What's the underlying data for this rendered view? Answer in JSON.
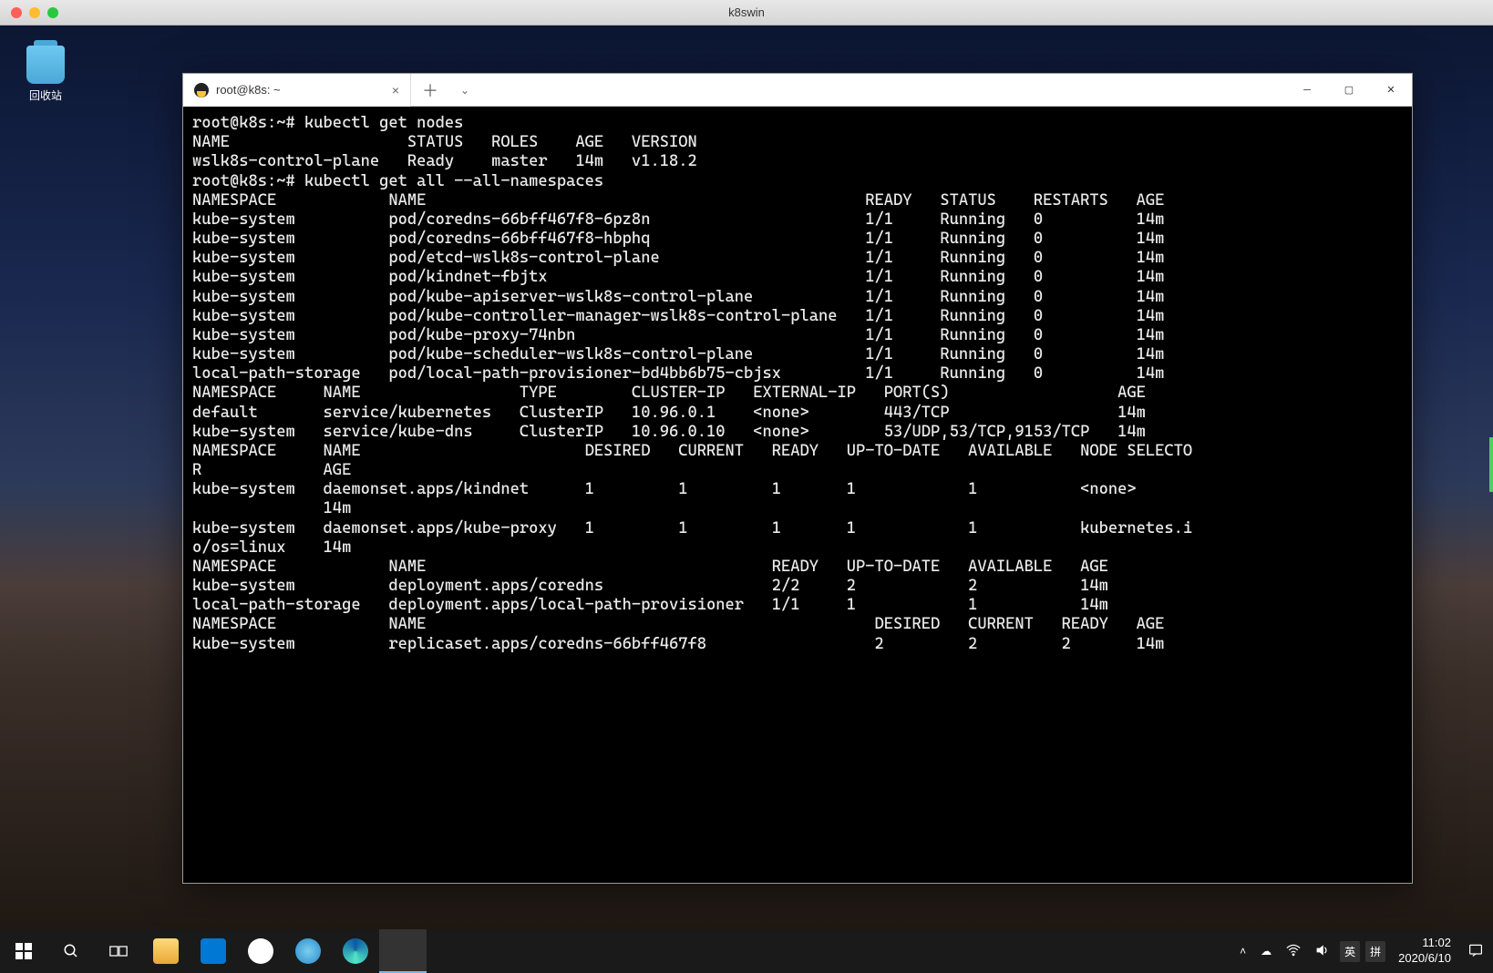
{
  "mac_titlebar": {
    "title": "k8swin"
  },
  "desktop": {
    "recycle_bin_label": "回收站"
  },
  "terminal": {
    "tab_title": "root@k8s: ~",
    "lines": [
      "root@k8s:~# kubectl get nodes",
      "NAME                   STATUS   ROLES    AGE   VERSION",
      "wslk8s-control-plane   Ready    master   14m   v1.18.2",
      "root@k8s:~# kubectl get all --all-namespaces",
      "NAMESPACE            NAME                                               READY   STATUS    RESTARTS   AGE",
      "kube-system          pod/coredns-66bff467f8-6pz8n                       1/1     Running   0          14m",
      "kube-system          pod/coredns-66bff467f8-hbphq                       1/1     Running   0          14m",
      "kube-system          pod/etcd-wslk8s-control-plane                      1/1     Running   0          14m",
      "kube-system          pod/kindnet-fbjtx                                  1/1     Running   0          14m",
      "kube-system          pod/kube-apiserver-wslk8s-control-plane            1/1     Running   0          14m",
      "kube-system          pod/kube-controller-manager-wslk8s-control-plane   1/1     Running   0          14m",
      "kube-system          pod/kube-proxy-74nbn                               1/1     Running   0          14m",
      "kube-system          pod/kube-scheduler-wslk8s-control-plane            1/1     Running   0          14m",
      "local-path-storage   pod/local-path-provisioner-bd4bb6b75-cbjsx         1/1     Running   0          14m",
      "",
      "NAMESPACE     NAME                 TYPE        CLUSTER-IP   EXTERNAL-IP   PORT(S)                  AGE",
      "default       service/kubernetes   ClusterIP   10.96.0.1    <none>        443/TCP                  14m",
      "kube-system   service/kube-dns     ClusterIP   10.96.0.10   <none>        53/UDP,53/TCP,9153/TCP   14m",
      "",
      "NAMESPACE     NAME                        DESIRED   CURRENT   READY   UP-TO-DATE   AVAILABLE   NODE SELECTO",
      "R             AGE",
      "kube-system   daemonset.apps/kindnet      1         1         1       1            1           <none>      ",
      "              14m",
      "kube-system   daemonset.apps/kube-proxy   1         1         1       1            1           kubernetes.i",
      "o/os=linux    14m",
      "",
      "NAMESPACE            NAME                                     READY   UP-TO-DATE   AVAILABLE   AGE",
      "kube-system          deployment.apps/coredns                  2/2     2            2           14m",
      "local-path-storage   deployment.apps/local-path-provisioner   1/1     1            1           14m",
      "",
      "NAMESPACE            NAME                                                DESIRED   CURRENT   READY   AGE",
      "kube-system          replicaset.apps/coredns-66bff467f8                  2         2         2       14m"
    ]
  },
  "taskbar": {
    "ime1": "英",
    "ime2": "拼",
    "time": "11:02",
    "date": "2020/6/10"
  }
}
